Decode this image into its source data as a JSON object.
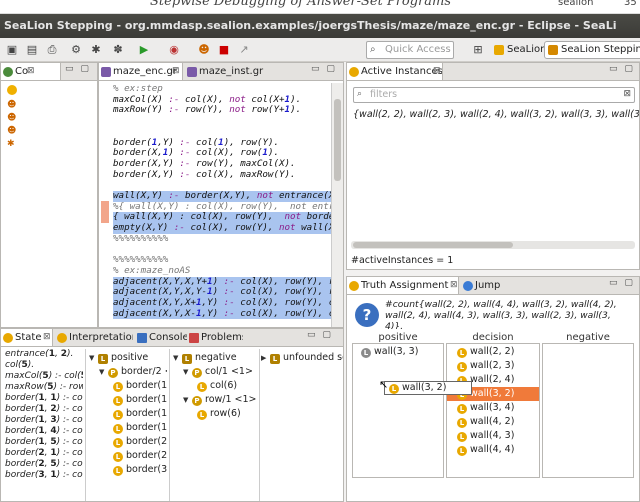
{
  "header": {
    "left": "Stepwise Debugging of Answer-Set Programs",
    "right_user": "sealion",
    "page": "35"
  },
  "window": {
    "title": "SeaLion Stepping - org.mmdasp.sealion.examples/joergsThesis/maze/maze_enc.gr - Eclipse - SeaLi"
  },
  "toolbar": {
    "quick_access": "Quick Access",
    "persp_sealion": "SeaLion",
    "persp_stepping": "SeaLion Stepping"
  },
  "left_view": {
    "tab": "Co"
  },
  "editor": {
    "tab1": "maze_enc.gr",
    "tab2": "maze_inst.gr",
    "lines": [
      "% ex:step",
      "maxCol(X) :- col(X), not col(X+1).",
      "maxRow(Y) :- row(Y), not row(Y+1).",
      "",
      "",
      "border(1,Y) :- col(1), row(Y).",
      "border(X,1) :- col(X), row(1).",
      "border(X,Y) :- row(Y), maxCol(X).",
      "border(X,Y) :- col(X), maxRow(Y).",
      "",
      "wall(X,Y) :- border(X,Y), not entrance(X,Y",
      "%{ wall(X,Y) : col(X), row(Y),  not entran",
      "{ wall(X,Y) : col(X), row(Y),  not border(",
      "empty(X,Y) :- col(X), row(Y), not wall(X,Y",
      "%%%%%%%%%%",
      "",
      "%%%%%%%%%%",
      "% ex:maze_noAS",
      "adjacent(X,Y,X,Y+1) :- col(X), row(Y), row",
      "adjacent(X,Y,X,Y-1) :- col(X), row(Y), row",
      "adjacent(X,Y,X+1,Y) :- col(X), row(Y), col",
      "adjacent(X,Y,X-1,Y) :- col(X), row(Y), col"
    ]
  },
  "active_instances": {
    "tab": "Active Instances",
    "filter_placeholder": "filters",
    "content": "{wall(2, 2), wall(2, 3), wall(2, 4), wall(3, 2), wall(3, 3), wall(3, 4), wall(4, 2), wall(4,",
    "count": "#activeInstances = 1"
  },
  "truth": {
    "tab": "Truth Assignment",
    "tab2": "Jump",
    "formula": "#count{wall(2, 2), wall(4, 4), wall(3, 2), wall(4, 2), wall(2, 4), wall(4, 3), wall(3, 3), wall(2, 3), wall(3, 4)}.",
    "col_positive": "positive",
    "col_decision": "decision",
    "col_negative": "negative",
    "positive": [
      "wall(3, 3)"
    ],
    "decision": [
      "wall(2, 2)",
      "wall(2, 3)",
      "wall(2, 4)",
      "wall(3, 2)",
      "wall(3, 4)",
      "wall(4, 2)",
      "wall(4, 3)",
      "wall(4, 4)"
    ],
    "drag": "wall(3, 2)"
  },
  "bottom": {
    "tab_state": "State",
    "tab_interp": "Interpretation",
    "tab_console": "Console",
    "tab_problems": "Problems",
    "state": [
      "entrance(1, 2).",
      "col(5).",
      "maxCol(5) :- col(5)",
      "maxRow(5) :- row",
      "border(1, 1) :- col(",
      "border(1, 2) :- col(",
      "border(1, 3) :- col(",
      "border(1, 4) :- col(",
      "border(1, 5) :- col(",
      "border(2, 1) :- col(",
      "border(2, 5) :- col(",
      "border(3, 1) :- col("
    ],
    "positive": "positive",
    "border": "border/2 <1>",
    "border_items": [
      "border(1,",
      "border(1,",
      "border(1,",
      "border(1,",
      "border(2,",
      "border(2,",
      "border(3,"
    ],
    "negative": "negative",
    "col_rule": "col/1 <1>",
    "col6": "col(6)",
    "row_rule": "row/1 <1>",
    "row6": "row(6)",
    "unfounded": "unfounded set"
  }
}
